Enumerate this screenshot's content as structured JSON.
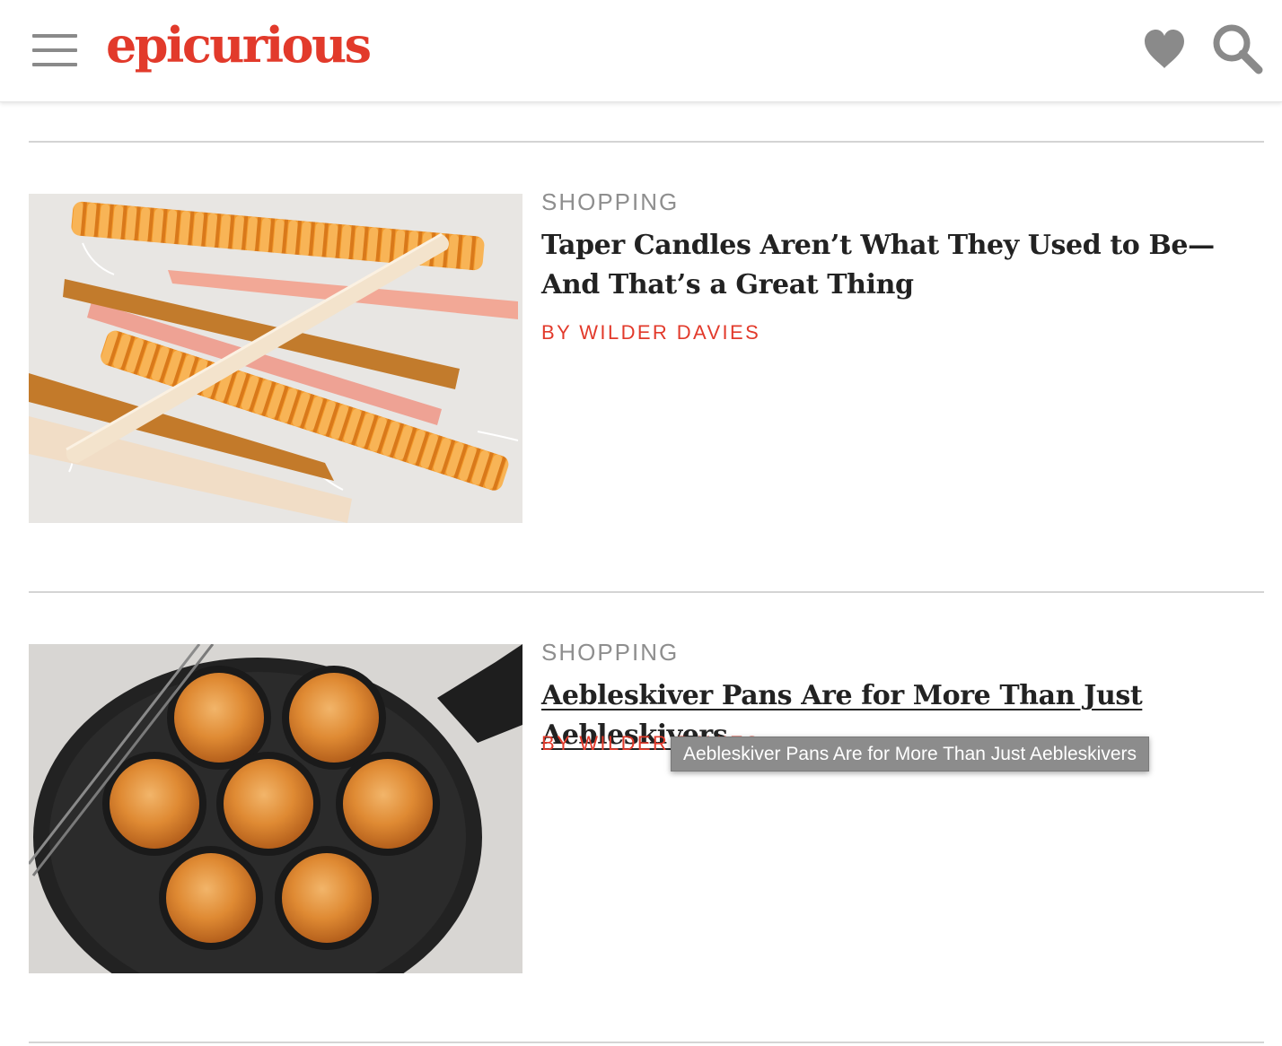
{
  "header": {
    "logo_text": "epicurious",
    "menu_icon": "hamburger-menu-icon",
    "favorites_icon": "heart-icon",
    "search_icon": "search-icon"
  },
  "colors": {
    "brand": "#e23a2b",
    "category": "#8e8e8e",
    "headline": "#222222",
    "icon_gray": "#8a8a8a"
  },
  "articles": [
    {
      "category": "SHOPPING",
      "headline": "Taper Candles Aren’t What They Used to Be—And That’s a Great Thing",
      "byline": "BY WILDER DAVIES",
      "image_subject": "taper candles"
    },
    {
      "category": "SHOPPING",
      "headline": "Aebleskiver Pans Are for More Than Just Aebleskivers",
      "byline": "BY WILDER DAVIES",
      "image_subject": "aebleskiver pan"
    }
  ],
  "tooltip": {
    "text": "Aebleskiver Pans Are for More Than Just Aebleskivers"
  }
}
